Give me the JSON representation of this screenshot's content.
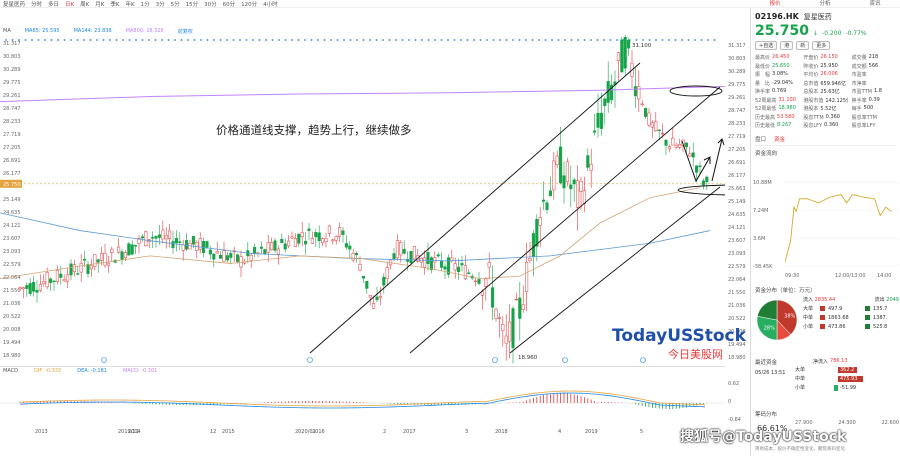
{
  "toolbar": {
    "items": [
      "复星医药",
      "分时",
      "多日",
      "日K",
      "周K",
      "月K",
      "季K",
      "年K",
      "1分",
      "3分",
      "5分",
      "15分",
      "30分",
      "60分",
      "120分",
      "4小时"
    ],
    "active_index": 3
  },
  "right_tabs": [
    "报价",
    "分析",
    "资讯"
  ],
  "ma_legend": [
    {
      "label": "MA",
      "color": "#555555"
    },
    {
      "label": "MA65: 25.595",
      "color": "#1e88e5"
    },
    {
      "label": "MA144: 23.836",
      "color": "#1e88e5"
    },
    {
      "label": "MA800: 28.326",
      "color": "#c084fc"
    },
    {
      "label": "前复权",
      "color": "#1e88e5"
    }
  ],
  "annotation": "价格通道线支撑，趋势上行，继续做多",
  "watermark": {
    "brand": "TodayUSStock",
    "cn": "今日美股网",
    "footer": "搜狐号@TodayUSStock"
  },
  "price_labels": {
    "high": "31.100",
    "low": "18.960",
    "current": "25.750"
  },
  "yaxis": [
    "31.317",
    "30.803",
    "30.289",
    "29.775",
    "29.261",
    "28.747",
    "28.233",
    "27.719",
    "27.205",
    "26.691",
    "26.177",
    "25.663",
    "25.149",
    "24.635",
    "24.121",
    "23.607",
    "23.093",
    "22.579",
    "22.064",
    "21.550",
    "21.036",
    "20.522",
    "20.008",
    "19.494",
    "18.980"
  ],
  "yaxis_left": [
    "31.317",
    "30.803",
    "30.289",
    "29.775",
    "29.261",
    "28.747",
    "28.233",
    "27.719",
    "27.205",
    "26.691",
    "26.177",
    "25.750",
    "25.149",
    "24.635",
    "24.121",
    "23.607",
    "23.093",
    "22.579",
    "22.064",
    "21.550",
    "21.036",
    "20.522",
    "20.008",
    "19.494",
    "18.980"
  ],
  "macd_legend": [
    {
      "label": "MACD",
      "color": "#555555"
    },
    {
      "label": "DIF: -0.332",
      "color": "#e6a23c"
    },
    {
      "label": "DEA: -0.181",
      "color": "#1e88e5"
    },
    {
      "label": "MACD: -0.301",
      "color": "#c084fc"
    }
  ],
  "macd_axis": [
    "0.62",
    "0",
    "-0.64"
  ],
  "xaxis": [
    "2013",
    "2019/11",
    "2014",
    "12",
    "2015",
    "2020/01",
    "2016",
    "2",
    "2017",
    "3",
    "2018",
    "4",
    "2019",
    "5"
  ],
  "quote": {
    "code": "02196.HK",
    "name": "复星医药",
    "price": "25.750",
    "arrow": "↓",
    "change": "-0.200",
    "change_pct": "-0.77%",
    "buttons": [
      "+自选",
      "港",
      "新",
      "更多"
    ],
    "fields": [
      [
        {
          "k": "最高价",
          "v": "26.450",
          "c": "v"
        },
        {
          "k": "开盘价",
          "v": "26.150",
          "c": "v"
        },
        {
          "k": "成交量",
          "v": "218",
          "c": "n"
        }
      ],
      [
        {
          "k": "最低价",
          "v": "25.650",
          "c": "g"
        },
        {
          "k": "昨收价",
          "v": "25.950",
          "c": "n"
        },
        {
          "k": "成交额",
          "v": "566",
          "c": "n"
        }
      ],
      [
        {
          "k": "振　幅",
          "v": "3.08%",
          "c": "n"
        },
        {
          "k": "平均价",
          "v": "26.006",
          "c": "v"
        },
        {
          "k": "市盈率",
          "v": "",
          "c": "n"
        }
      ],
      [
        {
          "k": "量　比",
          "v": "-29.04%",
          "c": "n"
        },
        {
          "k": "总市值",
          "v": "659.946亿",
          "c": "n"
        },
        {
          "k": "市净率",
          "v": "",
          "c": "n"
        }
      ],
      [
        {
          "k": "换手率",
          "v": "0.769",
          "c": "n"
        },
        {
          "k": "总股本",
          "v": "25.63亿",
          "c": "n"
        },
        {
          "k": "市盈TTM",
          "v": "1.8",
          "c": "n"
        }
      ],
      [
        {
          "k": "52周最高",
          "v": "31.100",
          "c": "v"
        },
        {
          "k": "港股市值",
          "v": "142.125亿",
          "c": "n"
        },
        {
          "k": "换手率",
          "v": "0.39",
          "c": "n"
        }
      ],
      [
        {
          "k": "52周最低",
          "v": "18.980",
          "c": "g"
        },
        {
          "k": "港股本",
          "v": "5.52亿",
          "c": "n"
        },
        {
          "k": "每手",
          "v": "500",
          "c": "n"
        }
      ],
      [
        {
          "k": "历史最高",
          "v": "53.580",
          "c": "v"
        },
        {
          "k": "股息TTM",
          "v": "0.360",
          "c": "n"
        },
        {
          "k": "股息率TTM",
          "v": "",
          "c": "n"
        }
      ],
      [
        {
          "k": "历史最低",
          "v": "8.267",
          "c": "g"
        },
        {
          "k": "股息LFY",
          "v": "0.360",
          "c": "n"
        },
        {
          "k": "股息率LFY",
          "v": "",
          "c": "n"
        }
      ]
    ]
  },
  "fund_flow": {
    "tabs": [
      "盘口",
      "资金"
    ],
    "title": "资金流向",
    "yticks": [
      "10.88M",
      "7.24M",
      "3.6M",
      "-38.45K"
    ],
    "xticks": [
      "09:30",
      "12:00/13:00",
      "14:00"
    ],
    "intraday": [
      [
        0,
        0.95
      ],
      [
        0.05,
        0.7
      ],
      [
        0.08,
        0.3
      ],
      [
        0.1,
        0.35
      ],
      [
        0.13,
        0.2
      ],
      [
        0.2,
        0.2
      ],
      [
        0.3,
        0.25
      ],
      [
        0.4,
        0.18
      ],
      [
        0.5,
        0.15
      ],
      [
        0.55,
        0.25
      ],
      [
        0.6,
        0.15
      ],
      [
        0.7,
        0.18
      ],
      [
        0.8,
        0.2
      ],
      [
        0.85,
        0.4
      ],
      [
        0.9,
        0.3
      ],
      [
        0.95,
        0.35
      ]
    ],
    "dist_title": "资金分布（单位：万元）",
    "inflow_label": "流入",
    "inflow": "2835.44",
    "outflow_label": "流出",
    "outflow": "2049",
    "pie": [
      {
        "pct": 38,
        "label": "38%",
        "color": "#c0392b"
      },
      {
        "pct": 12,
        "label": "",
        "color": "#e74c3c"
      },
      {
        "pct": 28,
        "label": "28%",
        "color": "#27ae60"
      },
      {
        "pct": 22,
        "label": "",
        "color": "#1e7e34"
      }
    ],
    "rows": [
      {
        "name": "大单",
        "in": "497.9",
        "out": "135.7"
      },
      {
        "name": "中单",
        "in": "1863.68",
        "out": "1387."
      },
      {
        "name": "小单",
        "in": "473.86",
        "out": "525.8"
      }
    ],
    "recent_title": "最近资金",
    "net_label": "净流入",
    "net": "786.13",
    "date": "05/26 13:51",
    "net_rows": [
      {
        "name": "大单",
        "val": "362.2",
        "frac": 0.45,
        "color": "#c0392b"
      },
      {
        "name": "中单",
        "val": "475.93",
        "frac": 0.6,
        "color": "#c0392b"
      },
      {
        "name": "小单",
        "val": "-51.99",
        "frac": 0.1,
        "color": "#27ae60"
      }
    ],
    "chip_title": "筹码分布",
    "chip_ticks": [
      "27.900",
      "24.300",
      "22.600"
    ],
    "chip_pct": "66.61%",
    "chip_foot": "简易成本，股价不确定性变化，聚焦筹码变化"
  }
}
